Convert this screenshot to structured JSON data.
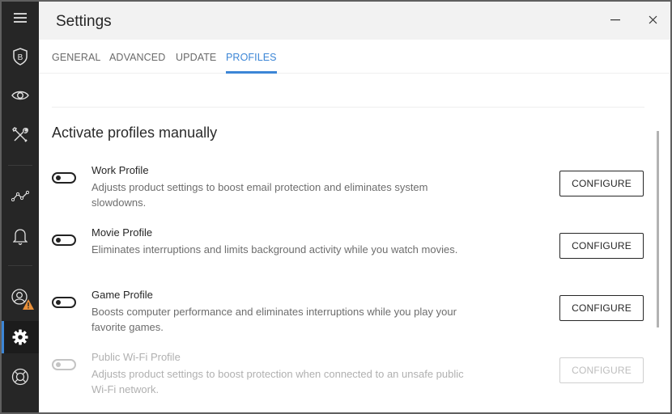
{
  "window": {
    "title": "Settings",
    "minimize_icon": "minimize-icon",
    "close_icon": "close-icon"
  },
  "sidebar": {
    "items": [
      {
        "id": "menu",
        "icon": "hamburger-menu-icon",
        "active": false
      },
      {
        "id": "protection",
        "icon": "shield-b-icon",
        "active": false
      },
      {
        "id": "privacy",
        "icon": "eye-icon",
        "active": false
      },
      {
        "id": "utilities",
        "icon": "tools-icon",
        "active": false
      },
      {
        "id": "activity",
        "icon": "activity-graph-icon",
        "active": false
      },
      {
        "id": "notifications",
        "icon": "bell-icon",
        "active": false
      },
      {
        "id": "account",
        "icon": "user-warning-icon",
        "active": false,
        "badge": "warning"
      },
      {
        "id": "settings",
        "icon": "gear-icon",
        "active": true
      },
      {
        "id": "support",
        "icon": "lifebuoy-icon",
        "active": false
      }
    ],
    "accent_color": "#3c86d6",
    "warning_color": "#e8903a"
  },
  "tabs": [
    {
      "label": "GENERAL",
      "active": false
    },
    {
      "label": "ADVANCED",
      "active": false
    },
    {
      "label": "UPDATE",
      "active": false
    },
    {
      "label": "PROFILES",
      "active": true
    }
  ],
  "main": {
    "section_title": "Activate profiles manually",
    "profiles": [
      {
        "name": "Work Profile",
        "description": "Adjusts product settings to boost email protection and eliminates system slowdowns.",
        "enabled": false,
        "disabled": false,
        "button_label": "CONFIGURE"
      },
      {
        "name": "Movie Profile",
        "description": "Eliminates interruptions and limits background activity while you watch movies.",
        "enabled": false,
        "disabled": false,
        "button_label": "CONFIGURE"
      },
      {
        "name": "Game Profile",
        "description": "Boosts computer performance and eliminates interruptions while you play your favorite games.",
        "enabled": false,
        "disabled": false,
        "button_label": "CONFIGURE"
      },
      {
        "name": "Public Wi-Fi Profile",
        "description": "Adjusts product settings to boost protection when connected to an unsafe public Wi-Fi network.",
        "enabled": false,
        "disabled": true,
        "button_label": "CONFIGURE"
      }
    ]
  }
}
